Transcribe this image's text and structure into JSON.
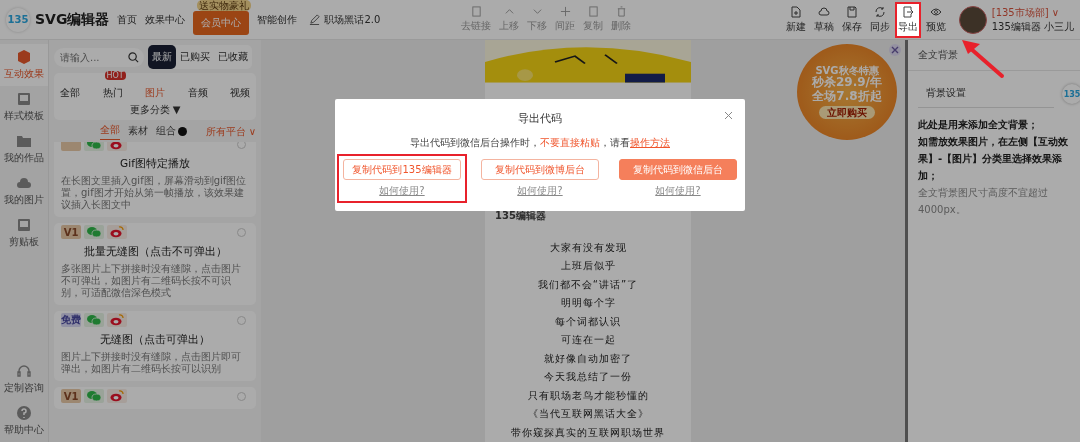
{
  "header": {
    "logo": "135",
    "app_name": "SVG编辑器",
    "nav": [
      {
        "label": "首页",
        "kind": "link"
      },
      {
        "label": "效果中心",
        "kind": "link"
      },
      {
        "label": "会员中心",
        "kind": "vip",
        "badge": "送实物豪礼"
      },
      {
        "label": "智能创作",
        "kind": "link"
      }
    ],
    "doc_title": "职场黑话2.0",
    "edit_tools": [
      {
        "label": "去链接"
      },
      {
        "label": "上移"
      },
      {
        "label": "下移"
      },
      {
        "label": "间距"
      },
      {
        "label": "复制"
      },
      {
        "label": "删除"
      }
    ],
    "actions": [
      {
        "label": "新建",
        "highlighted": false
      },
      {
        "label": "草稿",
        "highlighted": false
      },
      {
        "label": "保存",
        "highlighted": false
      },
      {
        "label": "同步",
        "highlighted": false
      },
      {
        "label": "导出",
        "highlighted": true
      },
      {
        "label": "预览",
        "highlighted": false
      }
    ],
    "user": {
      "team": "[135市场部] ∨",
      "name": "135编辑器 小三儿"
    }
  },
  "rail": {
    "items": [
      {
        "label": "互动效果",
        "selected": true
      },
      {
        "label": "样式模板",
        "selected": false
      },
      {
        "label": "我的作品",
        "selected": false
      },
      {
        "label": "我的图片",
        "selected": false
      },
      {
        "label": "剪贴板",
        "selected": false
      }
    ],
    "bottom": [
      {
        "label": "定制咨询"
      },
      {
        "label": "帮助中心"
      }
    ]
  },
  "panel": {
    "search": {
      "placeholder": "请输入..."
    },
    "sort_tabs": [
      {
        "label": "最新",
        "selected": true
      },
      {
        "label": "已购买",
        "selected": false
      },
      {
        "label": "已收藏",
        "selected": false
      }
    ],
    "categories": [
      {
        "label": "全部",
        "selected": false
      },
      {
        "label": "热门",
        "selected": false,
        "badge": "HOT"
      },
      {
        "label": "图片",
        "selected": true
      },
      {
        "label": "音频",
        "selected": false
      },
      {
        "label": "视频",
        "selected": false
      }
    ],
    "more": "更多分类 ▼",
    "sub_tabs": [
      {
        "label": "全部",
        "selected": true
      },
      {
        "label": "素材",
        "selected": false
      },
      {
        "label": "组合",
        "selected": false
      }
    ],
    "platform": "所有平台 ∨",
    "cards": [
      {
        "tags": [
          {
            "kind": "v1"
          },
          {
            "kind": "wechat"
          },
          {
            "kind": "weibo"
          }
        ],
        "title": "Gif图特定播放",
        "desc": "在长图文里插入gif图，屏幕滑动到gif图位置，gif图才开始从第一帧播放，该效果建议插入长图文中"
      },
      {
        "tags": [
          {
            "kind": "v1",
            "text": "V1"
          },
          {
            "kind": "wechat"
          },
          {
            "kind": "weibo"
          }
        ],
        "title": "批量无缝图（点击不可弹出）",
        "desc": "多张图片上下拼接时没有缝隙，点击图片不可弹出，如图片有二维码长按不可识别，可适配微信深色模式"
      },
      {
        "tags": [
          {
            "kind": "free",
            "text": "免费"
          },
          {
            "kind": "wechat"
          },
          {
            "kind": "weibo"
          }
        ],
        "title": "无缝图（点击可弹出）",
        "desc": "图片上下拼接时没有缝隙，点击图片即可弹出，如图片有二维码长按可以识别"
      },
      {
        "tags": [
          {
            "kind": "v1",
            "text": "V1"
          },
          {
            "kind": "wechat"
          },
          {
            "kind": "weibo"
          }
        ]
      }
    ]
  },
  "document": {
    "brand": "135编辑器",
    "lines": [
      "大家有没有发现",
      "上班后似乎",
      "我们都不会“讲话”了",
      "明明每个字",
      "每个词都认识",
      "可连在一起",
      "就好像自动加密了",
      "今天我总结了一份",
      "只有职场老鸟才能秒懂的",
      "《当代互联网黑话大全》",
      "带你窥探真实的互联网职场世界"
    ]
  },
  "promo": {
    "line_1": "SVG秋冬特惠",
    "line_2": "秒杀29.9/年",
    "line_3": "全场7.8折起",
    "button": "立即购买"
  },
  "right_panel": {
    "title": "全文背景",
    "dropdown": "背景设置",
    "notes": [
      {
        "text": "此处是用来添加全文背景；",
        "kind": "bold"
      },
      {
        "text": "如需放效果图片，在左侧【互动效果】-【图片】分类里选择效果添加；",
        "kind": "bold"
      },
      {
        "text": "全文背景图尺寸高度不宜超过4000px。",
        "kind": "hint"
      }
    ],
    "float_logo": "135"
  },
  "dialog": {
    "title": "导出代码",
    "message": {
      "before": "导出代码到微信后台操作时，",
      "warning": "不要直接粘贴",
      "middle": "，请看",
      "link": "操作方法"
    },
    "options": [
      {
        "label": "复制代码到135编辑器",
        "kind": "outline",
        "help": "如何使用?",
        "highlighted": true
      },
      {
        "label": "复制代码到微博后台",
        "kind": "outline",
        "help": "如何使用?",
        "highlighted": false
      },
      {
        "label": "复制代码到微信后台",
        "kind": "filled",
        "help": "如何使用?",
        "highlighted": false
      }
    ]
  }
}
